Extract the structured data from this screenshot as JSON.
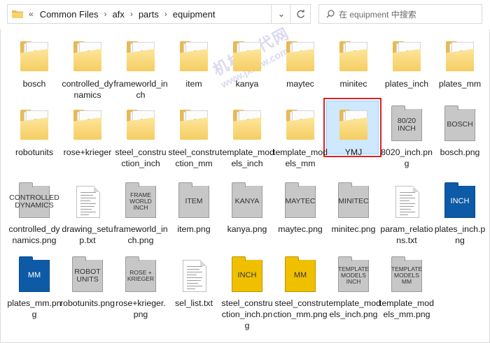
{
  "address": {
    "lead": "«",
    "crumbs": [
      "Common Files",
      "afx",
      "parts",
      "equipment"
    ],
    "dropdown_icon": "chevron-down-icon",
    "refresh_icon": "refresh-icon"
  },
  "search": {
    "placeholder": "在 equipment 中搜索"
  },
  "watermark": {
    "line1": "机械时代网",
    "line2": "www.jxsdw.com"
  },
  "items": [
    {
      "label": "bosch",
      "kind": "folder"
    },
    {
      "label": "controlled_dynamics",
      "kind": "folder"
    },
    {
      "label": "frameworld_inch",
      "kind": "folder"
    },
    {
      "label": "item",
      "kind": "folder"
    },
    {
      "label": "kanya",
      "kind": "folder"
    },
    {
      "label": "maytec",
      "kind": "folder"
    },
    {
      "label": "minitec",
      "kind": "folder"
    },
    {
      "label": "plates_inch",
      "kind": "folder"
    },
    {
      "label": "plates_mm",
      "kind": "folder"
    },
    {
      "label": "robotunits",
      "kind": "folder"
    },
    {
      "label": "rose+krieger",
      "kind": "folder"
    },
    {
      "label": "steel_construction_inch",
      "kind": "folder"
    },
    {
      "label": "steel_construction_mm",
      "kind": "folder"
    },
    {
      "label": "template_models_inch",
      "kind": "folder"
    },
    {
      "label": "template_models_mm",
      "kind": "folder"
    },
    {
      "label": "YMJ",
      "kind": "folder",
      "selected": true
    },
    {
      "label": "8020_inch.png",
      "kind": "png",
      "thumb": "80/20 INCH",
      "color": "gray"
    },
    {
      "label": "bosch.png",
      "kind": "png",
      "thumb": "BOSCH",
      "color": "gray"
    },
    {
      "label": "controlled_dynamics.png",
      "kind": "png",
      "thumb": "CONTROLLED DYNAMICS",
      "color": "gray"
    },
    {
      "label": "drawing_setup.txt",
      "kind": "txt"
    },
    {
      "label": "frameworld_inch.png",
      "kind": "png",
      "thumb": "FRAME WORLD INCH",
      "color": "gray"
    },
    {
      "label": "item.png",
      "kind": "png",
      "thumb": "ITEM",
      "color": "gray"
    },
    {
      "label": "kanya.png",
      "kind": "png",
      "thumb": "KANYA",
      "color": "gray"
    },
    {
      "label": "maytec.png",
      "kind": "png",
      "thumb": "MAYTEC",
      "color": "gray"
    },
    {
      "label": "minitec.png",
      "kind": "png",
      "thumb": "MINITEC",
      "color": "gray"
    },
    {
      "label": "param_relations.txt",
      "kind": "txt"
    },
    {
      "label": "plates_inch.png",
      "kind": "png",
      "thumb": "INCH",
      "color": "blue"
    },
    {
      "label": "plates_mm.png",
      "kind": "png",
      "thumb": "MM",
      "color": "blue"
    },
    {
      "label": "robotunits.png",
      "kind": "png",
      "thumb": "ROBOT UNITS",
      "color": "gray"
    },
    {
      "label": "rose+krieger.png",
      "kind": "png",
      "thumb": "ROSE + KRIEGER",
      "color": "gray"
    },
    {
      "label": "sel_list.txt",
      "kind": "txt"
    },
    {
      "label": "steel_construction_inch.png",
      "kind": "png",
      "thumb": "INCH",
      "color": "gold"
    },
    {
      "label": "steel_construction_mm.png",
      "kind": "png",
      "thumb": "MM",
      "color": "gold"
    },
    {
      "label": "template_models_inch.png",
      "kind": "png",
      "thumb": "TEMPLATE MODELS INCH",
      "color": "gray"
    },
    {
      "label": "template_models_mm.png",
      "kind": "png",
      "thumb": "TEMPLATE MODELS MM",
      "color": "gray"
    }
  ]
}
